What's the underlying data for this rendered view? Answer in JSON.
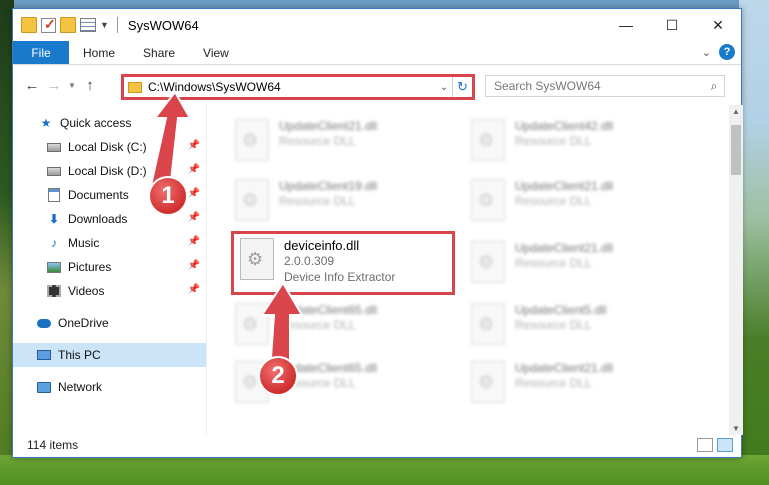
{
  "window": {
    "title": "SysWOW64",
    "controls": [
      "—",
      "☐",
      "✕"
    ]
  },
  "ribbon": {
    "tabs": [
      "File",
      "Home",
      "Share",
      "View"
    ]
  },
  "address": {
    "path": "C:\\Windows\\SysWOW64",
    "search_placeholder": "Search SysWOW64"
  },
  "sidebar": {
    "items": [
      {
        "label": "Quick access",
        "icon": "star-icon"
      },
      {
        "label": "Local Disk (C:)",
        "icon": "disk-icon",
        "pinned": true
      },
      {
        "label": "Local Disk (D:)",
        "icon": "disk-icon",
        "pinned": true
      },
      {
        "label": "Documents",
        "icon": "documents-icon",
        "pinned": true
      },
      {
        "label": "Downloads",
        "icon": "download-icon",
        "pinned": true
      },
      {
        "label": "Music",
        "icon": "music-icon",
        "pinned": true
      },
      {
        "label": "Pictures",
        "icon": "pictures-icon",
        "pinned": true
      },
      {
        "label": "Videos",
        "icon": "videos-icon",
        "pinned": true
      },
      {
        "label": "OneDrive",
        "icon": "cloud-icon"
      },
      {
        "label": "This PC",
        "icon": "pc-icon",
        "selected": true
      },
      {
        "label": "Network",
        "icon": "network-icon"
      }
    ]
  },
  "files": [
    {
      "name": "UpdateClient21.dll",
      "line2": "Resource DLL",
      "blurred": true
    },
    {
      "name": "UpdateClient42.dll",
      "line2": "Resource DLL",
      "blurred": true
    },
    {
      "name": "UpdateClient19.dll",
      "line2": "Resource DLL",
      "blurred": true
    },
    {
      "name": "UpdateClient21.dll",
      "line2": "Resource DLL",
      "blurred": true
    },
    {
      "name": "deviceinfo.dll",
      "line2": "2.0.0.309",
      "line3": "Device Info Extractor",
      "blurred": false
    },
    {
      "name": "UpdateClient21.dll",
      "line2": "Resource DLL",
      "blurred": true
    },
    {
      "name": "UpdateClient65.dll",
      "line2": "Resource DLL",
      "blurred": true
    },
    {
      "name": "UpdateClient5.dll",
      "line2": "Resource DLL",
      "blurred": true
    },
    {
      "name": "UpdateClient65.dll",
      "line2": "Resource DLL",
      "blurred": true
    },
    {
      "name": "UpdateClient21.dll",
      "line2": "Resource DLL",
      "blurred": true
    }
  ],
  "status": {
    "item_count": "114 items"
  },
  "annotations": {
    "step1": "1",
    "step2": "2",
    "color": "#d9454b"
  }
}
